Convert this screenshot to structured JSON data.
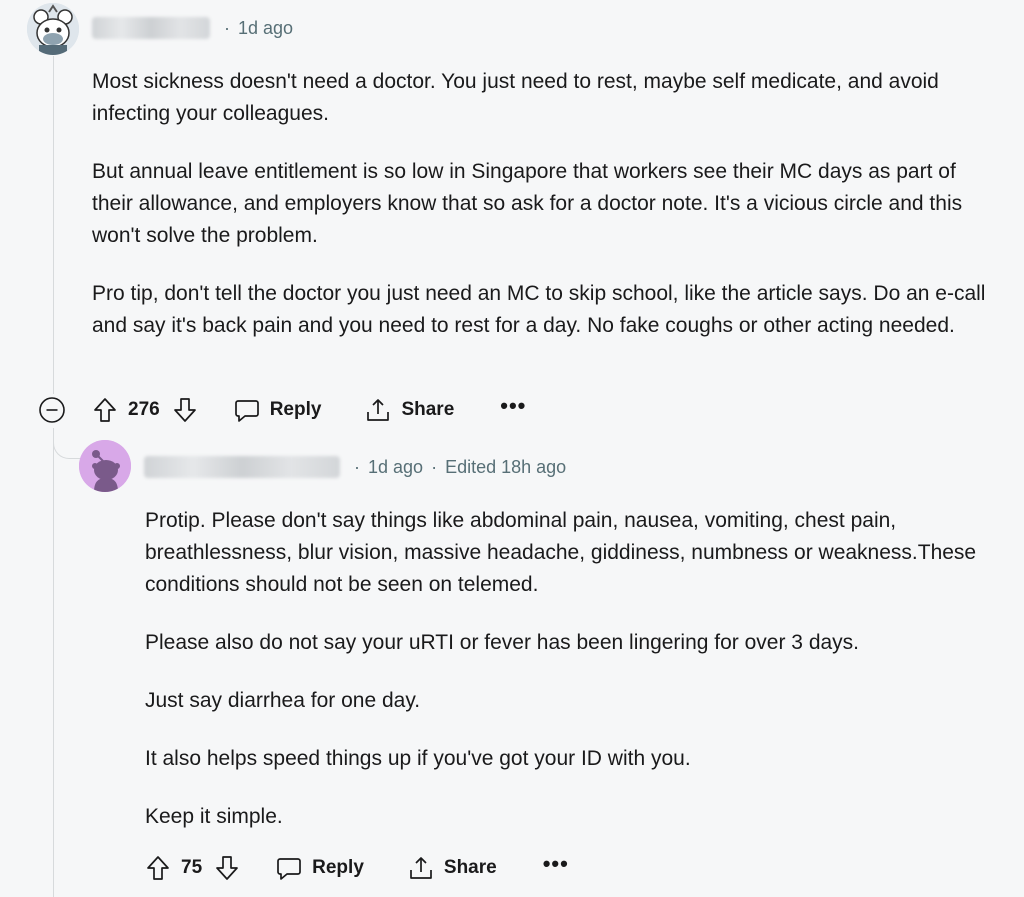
{
  "comment": {
    "time": "1d ago",
    "paragraphs": [
      "Most sickness doesn't need a doctor. You just need to rest, maybe self medicate, and avoid infecting your colleagues.",
      "But annual leave entitlement is so low in Singapore that workers see their MC days as part of their allowance, and employers know that so ask for a doctor note. It's a vicious circle and this won't solve the problem.",
      "Pro tip, don't tell the doctor you just need an MC to skip school, like the article says. Do an e-call and say it's back pain and you need to rest for a day. No fake coughs or other acting needed."
    ],
    "score": "276",
    "reply_label": "Reply",
    "share_label": "Share",
    "more_label": "•••"
  },
  "reply": {
    "time": "1d ago",
    "edited": "Edited 18h ago",
    "paragraphs": [
      "Protip. Please don't say things like abdominal pain, nausea, vomiting, chest pain, breathlessness, blur vision, massive headache, giddiness, numbness or weakness.These conditions should not be seen on telemed.",
      "Please also do not say your uRTI or fever has been lingering for over 3 days.",
      "Just say diarrhea for one day.",
      "It also helps speed things up if you've got your ID with you.",
      "Keep it simple."
    ],
    "score": "75",
    "reply_label": "Reply",
    "share_label": "Share",
    "more_label": "•••"
  },
  "icons": {
    "collapse": "minus-circle-icon",
    "upvote": "arrow-up-icon",
    "downvote": "arrow-down-icon",
    "reply": "speech-bubble-icon",
    "share": "share-icon",
    "more": "ellipsis-icon"
  },
  "colors": {
    "background": "#f6f7f8",
    "text": "#1a1a1b",
    "meta": "#576f76",
    "reply_avatar": "#d8a8e8"
  }
}
